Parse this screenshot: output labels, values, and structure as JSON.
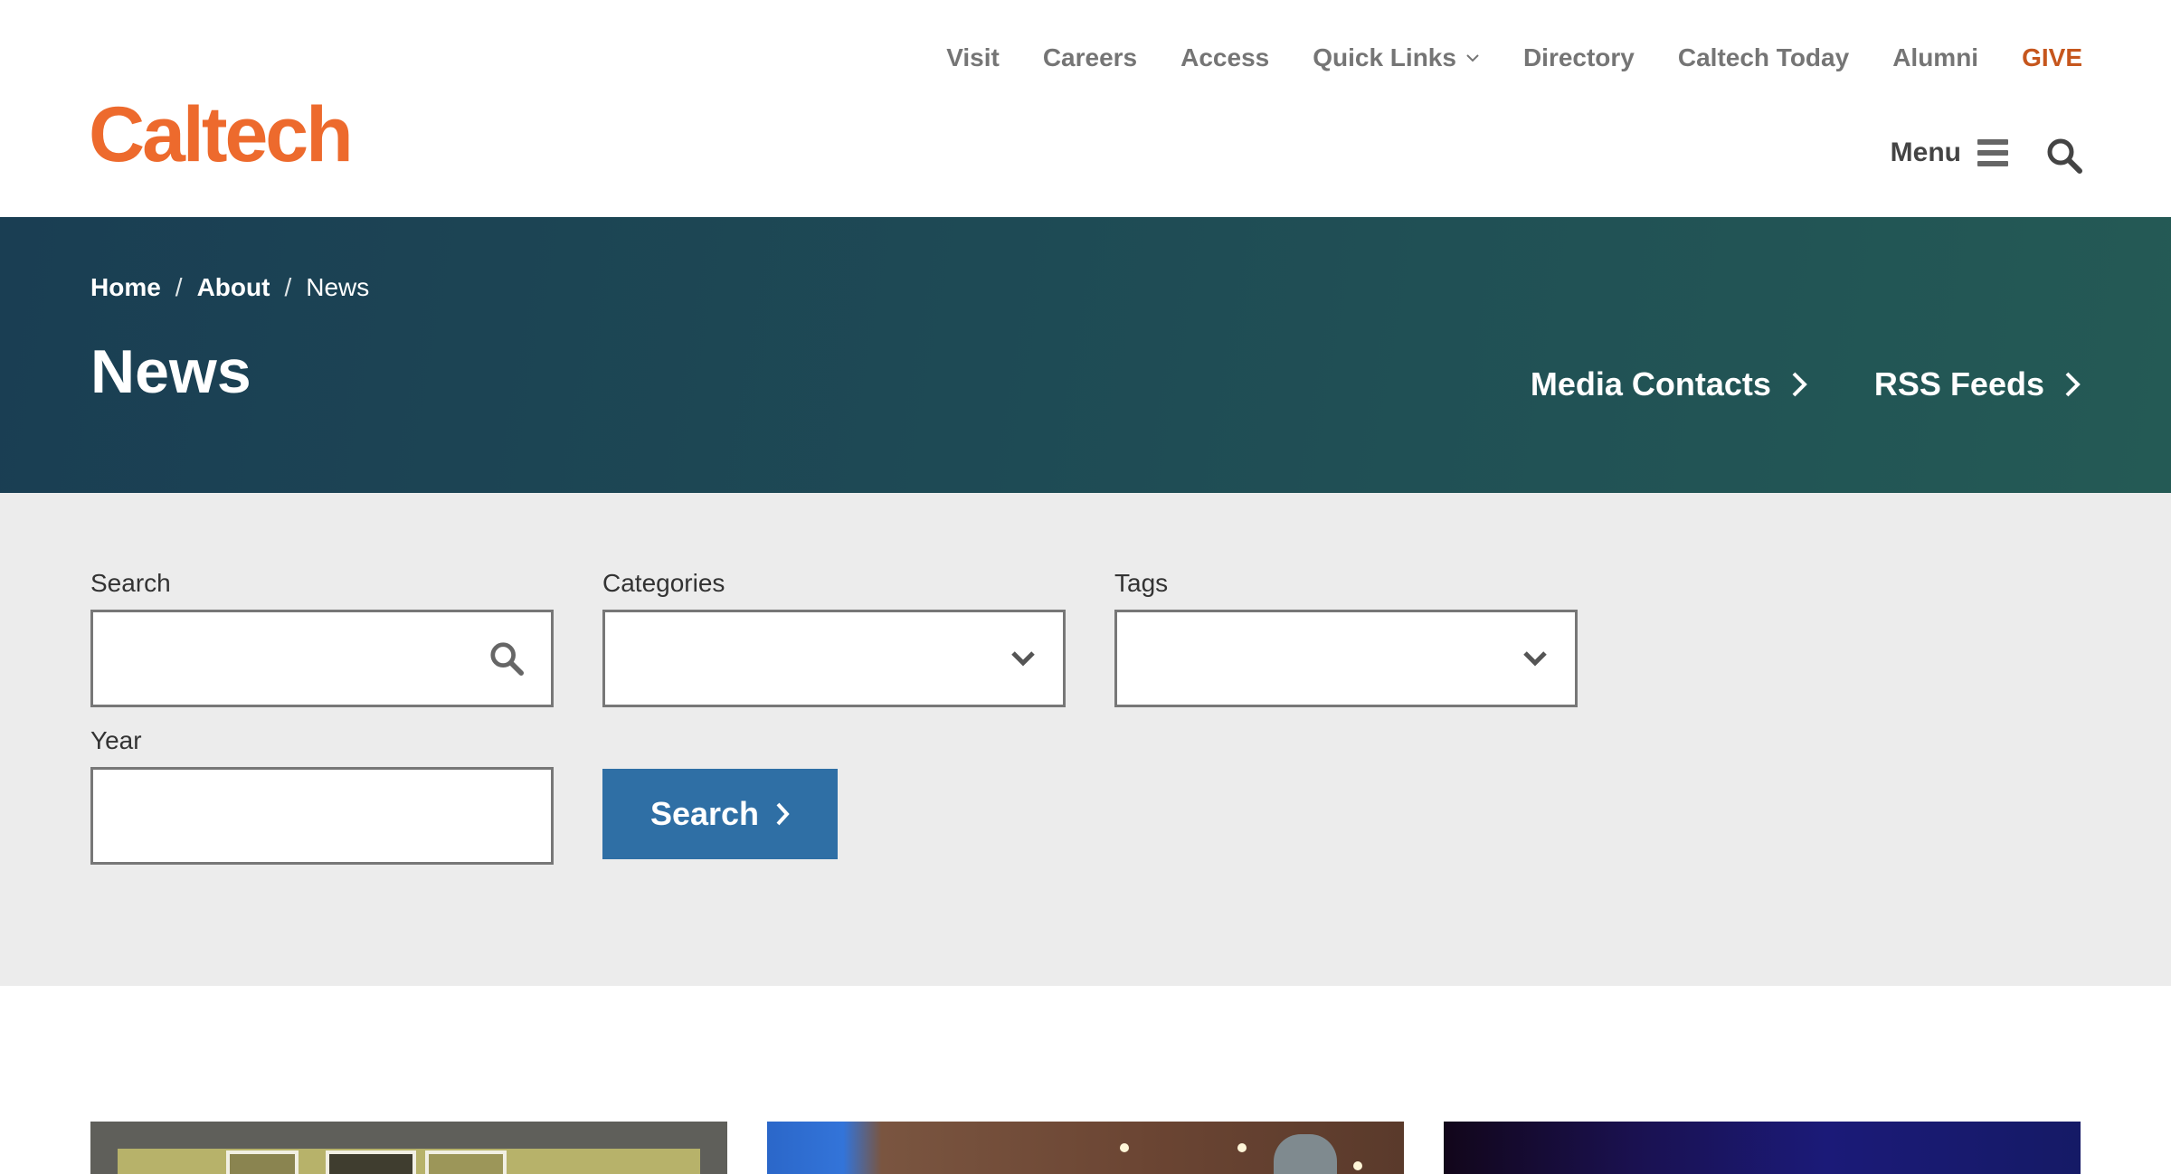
{
  "header": {
    "logo": "Caltech",
    "util_nav": [
      {
        "label": "Visit"
      },
      {
        "label": "Careers"
      },
      {
        "label": "Access"
      },
      {
        "label": "Quick Links"
      },
      {
        "label": "Directory"
      },
      {
        "label": "Caltech Today"
      },
      {
        "label": "Alumni"
      },
      {
        "label": "GIVE"
      }
    ],
    "menu_label": "Menu"
  },
  "banner": {
    "breadcrumb": [
      "Home",
      "About",
      "News"
    ],
    "breadcrumb_sep": "/",
    "title": "News",
    "links": [
      "Media Contacts",
      "RSS Feeds"
    ]
  },
  "filters": {
    "search_label": "Search",
    "search_value": "",
    "categories_label": "Categories",
    "categories_value": "",
    "tags_label": "Tags",
    "tags_value": "",
    "year_label": "Year",
    "year_value": "",
    "submit_label": "Search"
  },
  "colors": {
    "brand_orange": "#ed6a2d",
    "give_orange": "#c6561d",
    "banner_teal": "#1e4a55",
    "button_blue": "#2f6fa5",
    "filter_bg": "#ececec"
  },
  "icons": [
    "chevron-down-icon",
    "hamburger-icon",
    "search-icon",
    "chevron-right-icon"
  ]
}
